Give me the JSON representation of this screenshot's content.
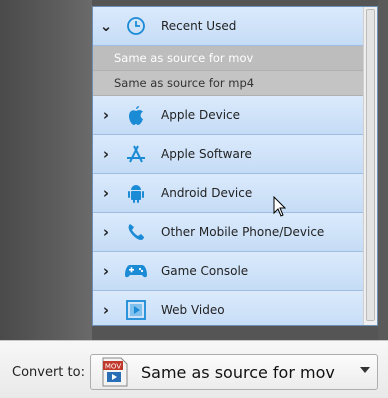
{
  "dropdown": {
    "recent": {
      "label": "Recent Used",
      "icon": "clock-icon",
      "expanded": true
    },
    "recent_items": [
      "Same as source for mov",
      "Same as source for mp4"
    ],
    "categories": [
      {
        "label": "Apple Device",
        "icon": "apple-icon"
      },
      {
        "label": "Apple Software",
        "icon": "app-store-icon"
      },
      {
        "label": "Android Device",
        "icon": "android-icon"
      },
      {
        "label": "Other Mobile Phone/Device",
        "icon": "phone-icon"
      },
      {
        "label": "Game Console",
        "icon": "gamepad-icon"
      },
      {
        "label": "Web Video",
        "icon": "film-icon"
      }
    ],
    "footer": {
      "collapse_all_icon": "collapse-all-icon",
      "expand_all_icon": "expand-all-icon"
    }
  },
  "convert": {
    "label": "Convert to:",
    "selected": "Same as source for mov",
    "selected_icon_text": "MOV"
  },
  "colors": {
    "accent": "#1b8bd6",
    "category_bg": "#c8ddf6",
    "recent_bg": "#c4c4c4"
  }
}
